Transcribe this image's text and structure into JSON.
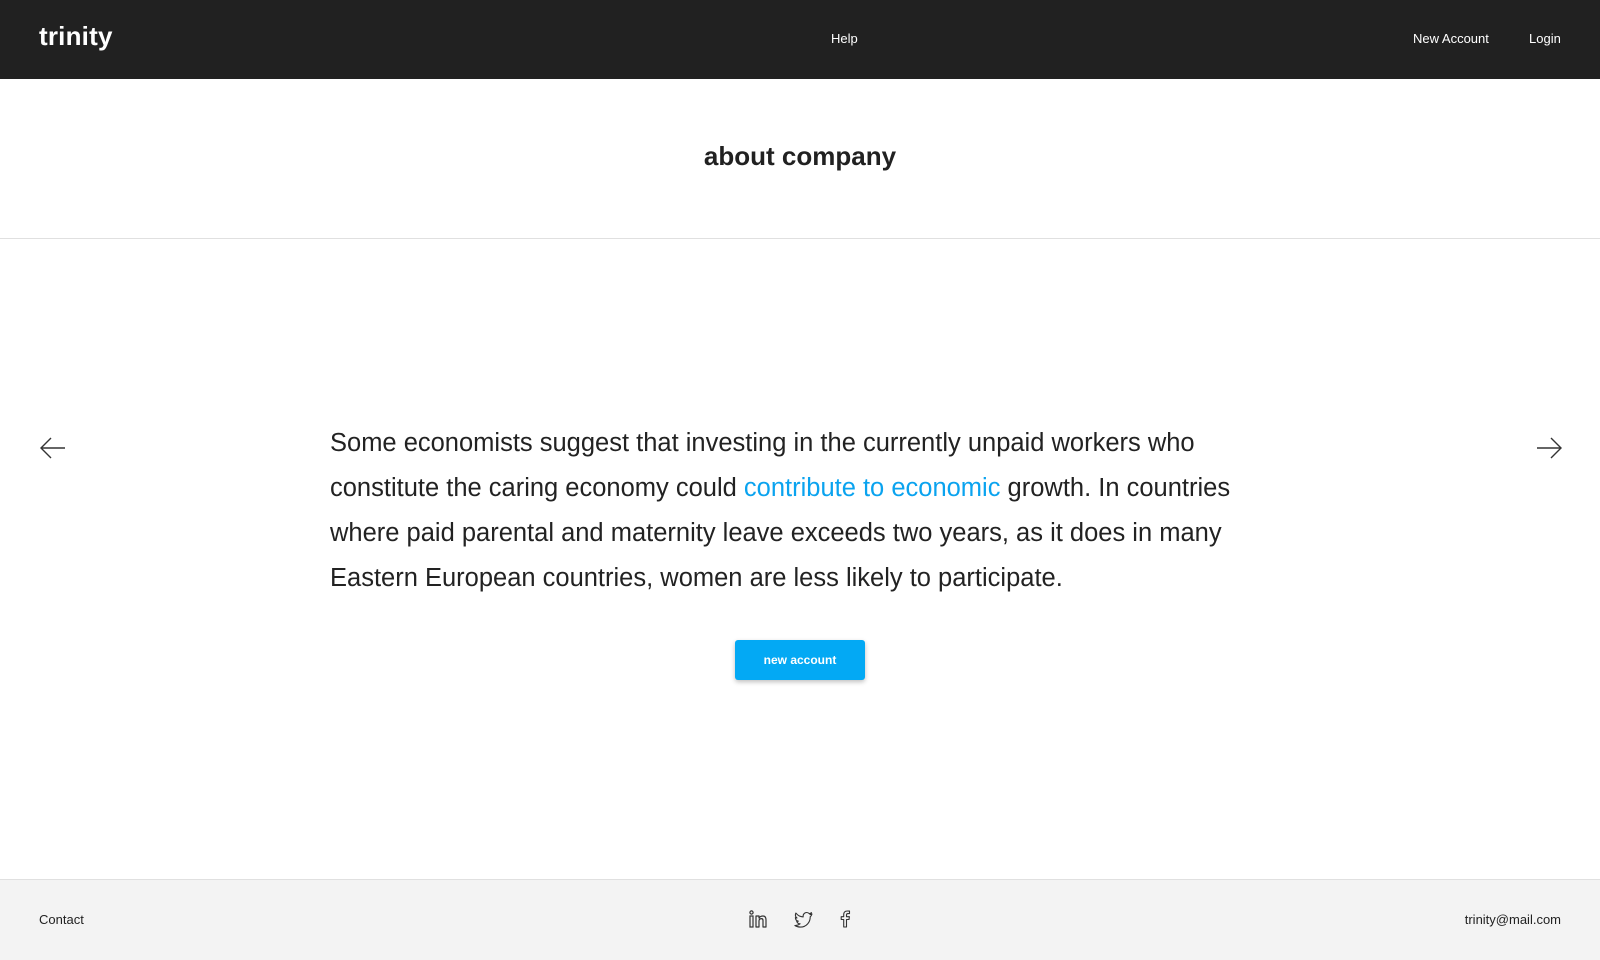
{
  "header": {
    "brand": "trinity",
    "nav": {
      "help": "Help",
      "new_account": "New Account",
      "login": "Login"
    }
  },
  "title_band": {
    "title": "about company"
  },
  "main": {
    "text_before_link": "Some economists suggest that investing in the currently unpaid workers who constitute the caring economy could ",
    "link_text": "contribute to economic",
    "text_after_link": " growth. In countries where paid parental and maternity leave exceeds two years, as it does in many Eastern European countries, women are less likely to participate.",
    "button_label": "new account",
    "prev_icon": "arrow-left-icon",
    "next_icon": "arrow-right-icon"
  },
  "footer": {
    "contact": "Contact",
    "email": "trinity@mail.com",
    "social": [
      "linkedin-icon",
      "twitter-icon",
      "facebook-icon"
    ]
  },
  "colors": {
    "header_bg": "#212121",
    "accent": "#03a9f4",
    "link": "#0aa3ef",
    "footer_bg": "#f3f3f3"
  }
}
